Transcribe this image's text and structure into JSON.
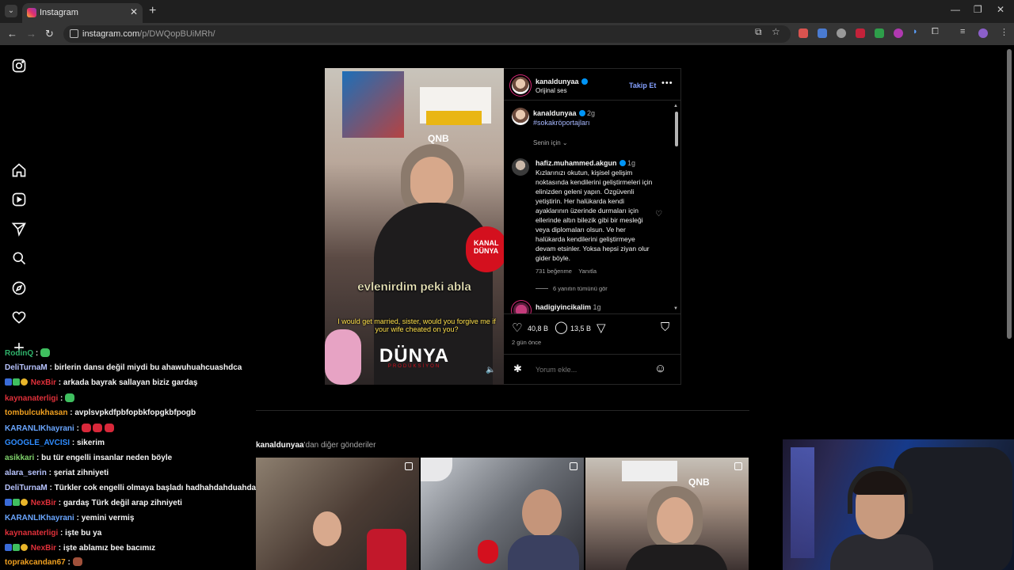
{
  "browser": {
    "tab_title": "Instagram",
    "url_host": "instagram.com",
    "url_path": "/p/DWQopBUiMRh/"
  },
  "post": {
    "author": "kanaldunyaa",
    "audio": "Orijinal ses",
    "follow_label": "Takip Et",
    "caption_author": "kanaldunyaa",
    "caption_age": "2g",
    "caption_tag": "#sokakröportajları",
    "sort_label": "Senin için",
    "video": {
      "caption": "evlenirdim peki abla",
      "subtitle": "I would get married, sister, would you forgive me if your wife cheated on you?",
      "logo": "DÜNYA",
      "logo_sub": "PRODÜKSİYON",
      "mic_text": "KANAL DÜNYA"
    },
    "comments": [
      {
        "user": "hafiz.muhammed.akgun",
        "age": "1g",
        "text": "Kızlarınızı okutun, kişisel gelişim noktasında kendilerini geliştirmeleri için elinizden geleni yapın. Özgüvenli yetiştirin. Her halükarda kendi ayaklarının üzerinde durmaları için ellerinde altın bilezik gibi bir mesleği veya diplomaları olsun. Ve her halükarda kendilerini geliştirmeye devam etsinler. Yoksa hepsi ziyan olur gider böyle.",
        "likes": "731 beğenme",
        "reply": "Yanıtla",
        "view_replies": "6 yanıtın tümünü gör"
      },
      {
        "user": "hadigiyincikalim",
        "age": "1g"
      }
    ],
    "like_count": "40,8 B",
    "comment_count": "13,5 B",
    "posted": "2 gün önce",
    "comment_placeholder": "Yorum ekle...",
    "more_posts_user": "kanaldunyaa",
    "more_posts_suffix": "'dan diğer gönderiler"
  },
  "chat": [
    {
      "user": "RodinQ",
      "color": "#2fb36b",
      "text": ""
    },
    {
      "user": "DeliTurnaM",
      "color": "#b8c4ff",
      "text": "birlerin dansı değil miydi bu ahawuhuahcuashdca"
    },
    {
      "user": "NexBir",
      "color": "#e0303a",
      "text": "arkada bayrak sallayan biziz gardaş"
    },
    {
      "user": "kaynanaterligi",
      "color": "#e0303a",
      "text": ""
    },
    {
      "user": "tombulcukhasan",
      "color": "#f0a020",
      "text": "avplsvpkdfpbfopbkfopgkbfpogb"
    },
    {
      "user": "KARANLIKhayrani",
      "color": "#6aa6ff",
      "text": ""
    },
    {
      "user": "GOOGLE_AVCISI",
      "color": "#2f8cff",
      "text": "sikerim"
    },
    {
      "user": "asikkari",
      "color": "#7fd26b",
      "text": "bu tür engelli insanlar neden böyle"
    },
    {
      "user": "alara_serin",
      "color": "#b8c4ff",
      "text": "şeriat zihniyeti"
    },
    {
      "user": "DeliTurnaM",
      "color": "#b8c4ff",
      "text": "Türkler cok engelli olmaya başladı hadhahdahduahda"
    },
    {
      "user": "NexBir",
      "color": "#e0303a",
      "text": "gardaş Türk değil arap zihniyeti"
    },
    {
      "user": "KARANLIKhayrani",
      "color": "#6aa6ff",
      "text": "yemini vermiş"
    },
    {
      "user": "kaynanaterligi",
      "color": "#e0303a",
      "text": "işte bu ya"
    },
    {
      "user": "NexBir",
      "color": "#e0303a",
      "text": "işte ablamız bee bacımız"
    },
    {
      "user": "toprakcandan67",
      "color": "#f0a020",
      "text": ""
    }
  ],
  "icons": {
    "nav": [
      "instagram-logo-icon",
      "home-icon",
      "reels-icon",
      "messages-icon",
      "search-icon",
      "explore-icon",
      "notifications-icon",
      "create-icon"
    ]
  },
  "colors": {
    "accent_blue": "#0095f6",
    "follow_link": "#85a1ff"
  }
}
